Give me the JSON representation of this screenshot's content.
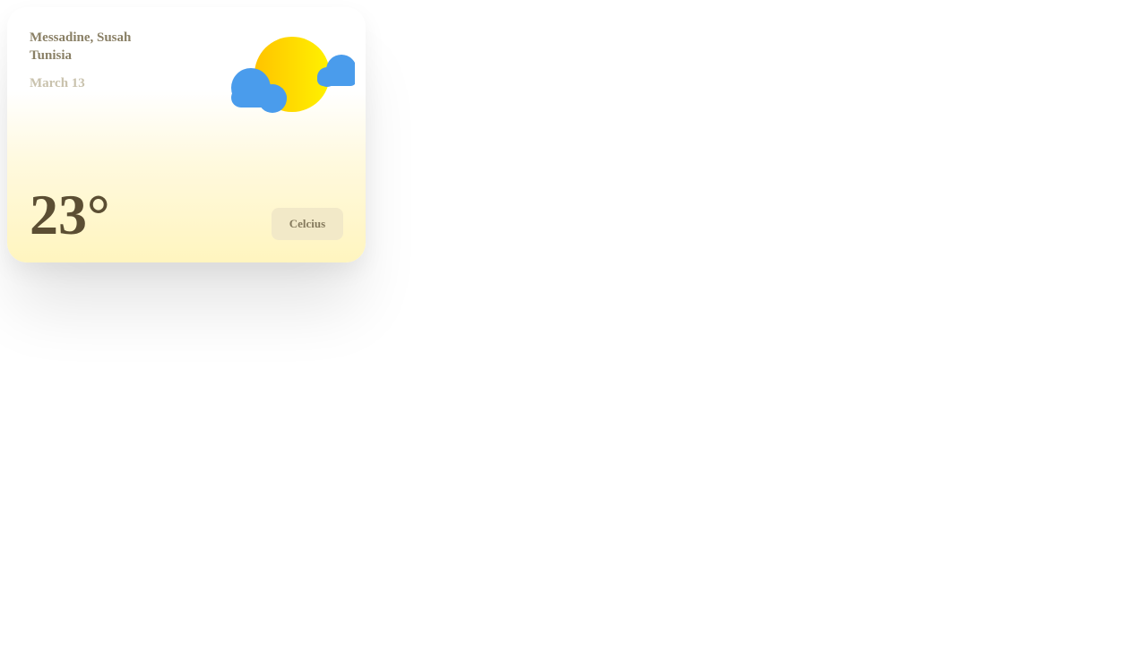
{
  "weather_card": {
    "location_line1": "Messadine, Susah",
    "location_line2": "Tunisia",
    "date": "March 13",
    "temperature": "23°",
    "unit_toggle_label": "Celcius",
    "icon": "partly-cloudy-sun-icon",
    "colors": {
      "sun_start": "#ffc300",
      "sun_end": "#fff200",
      "cloud": "#4a9cec",
      "temperature_text": "#5b4e33",
      "location_text": "#8a8066",
      "date_text": "#c9c2ad",
      "button_bg": "#f2e9c8"
    }
  }
}
